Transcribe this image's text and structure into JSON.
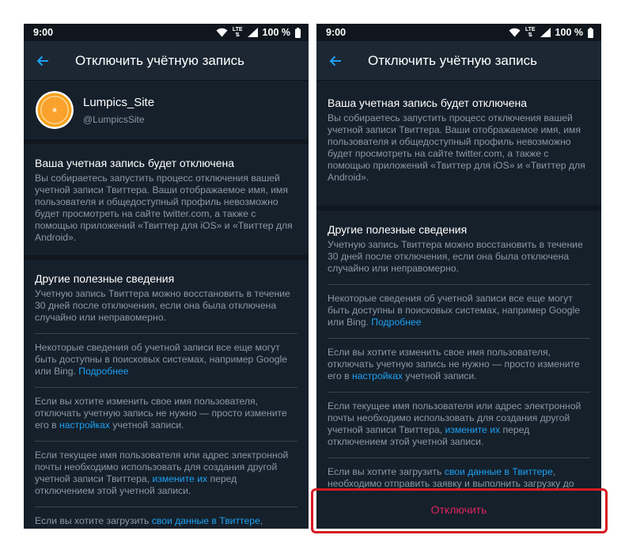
{
  "status_bar": {
    "time": "9:00",
    "network": "LTE",
    "battery": "100 %"
  },
  "header": {
    "title": "Отключить учётную запись"
  },
  "account": {
    "name": "Lumpics_Site",
    "handle": "@LumpicsSite"
  },
  "section1": {
    "title": "Ваша учетная запись будет отключена",
    "text": "Вы собираетесь запустить процесс отключения вашей учетной записи Твиттера. Ваши отображаемое имя, имя пользователя и общедоступный профиль невозможно будет просмотреть на сайте twitter.com, а также с помощью приложений «Твиттер для iOS» и «Твиттер для Android»."
  },
  "section2": {
    "title": "Другие полезные сведения",
    "p1": "Учетную запись Твиттера можно восстановить в течение 30 дней после отключения, если она была отключена случайно или неправомерно.",
    "p2": "Некоторые сведения об учетной записи все еще могут быть доступны в поисковых системах, например Google или Bing. ",
    "p2_link": "Подробнее",
    "p3_a": "Если вы хотите изменить свое имя пользователя, отключать учетную запись не нужно — просто измените его в ",
    "p3_link": "настройках",
    "p3_b": " учетной записи.",
    "p4_a": "Если текущее имя пользователя или адрес электронной почты необходимо использовать для создания другой учетной записи Твиттера, ",
    "p4_link": "измените их",
    "p4_b": " перед отключением этой учетной записи.",
    "p5_a": "Если вы хотите загрузить ",
    "p5_link": "свои данные в Твиттере",
    "p5_b": ", необходимо отправить заявку и выполнить загрузку до отключения учетной записи. Ссылки на загрузку данных владельцам отключенных учетных записей не"
  },
  "footer": {
    "disable_label": "Отключить"
  },
  "colors": {
    "background": "#15202b",
    "link": "#1da1f2",
    "danger": "#e0245e",
    "highlight": "#d71922"
  }
}
